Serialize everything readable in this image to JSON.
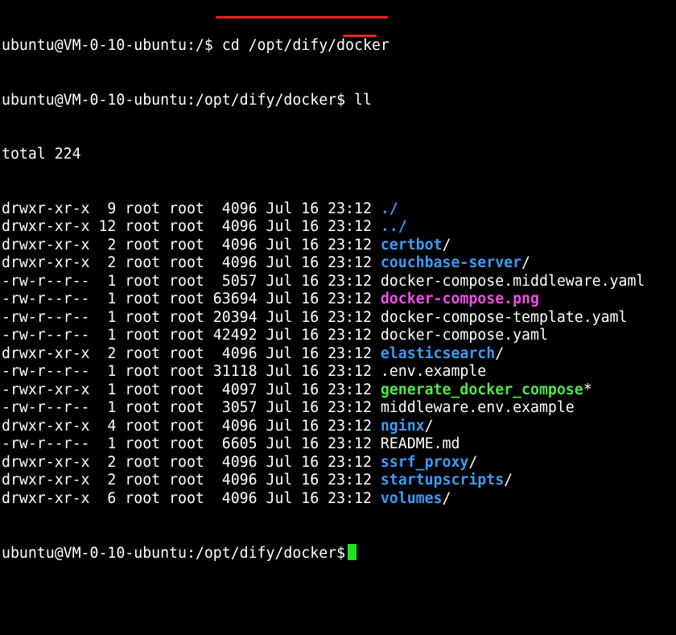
{
  "prompt_prefix_1": "ubuntu@VM-0-10-ubuntu:/$ ",
  "command_1": "cd /opt/dify/docker",
  "prompt_prefix_2": "ubuntu@VM-0-10-ubuntu:/opt/dify/docker$ ",
  "command_2": "ll",
  "total": "total 224",
  "listing": [
    {
      "meta": "drwxr-xr-x  9 root root  4096 Jul 16 23:12 ",
      "name": "./",
      "suffix": "",
      "kind": "dir"
    },
    {
      "meta": "drwxr-xr-x 12 root root  4096 Jul 16 23:12 ",
      "name": "../",
      "suffix": "",
      "kind": "dir"
    },
    {
      "meta": "drwxr-xr-x  2 root root  4096 Jul 16 23:12 ",
      "name": "certbot",
      "suffix": "/",
      "kind": "dir"
    },
    {
      "meta": "drwxr-xr-x  2 root root  4096 Jul 16 23:12 ",
      "name": "couchbase-server",
      "suffix": "/",
      "kind": "dir"
    },
    {
      "meta": "-rw-r--r--  1 root root  5057 Jul 16 23:12 ",
      "name": "docker-compose.middleware.yaml",
      "suffix": "",
      "kind": "plain"
    },
    {
      "meta": "-rw-r--r--  1 root root 63694 Jul 16 23:12 ",
      "name": "docker-compose.png",
      "suffix": "",
      "kind": "png"
    },
    {
      "meta": "-rw-r--r--  1 root root 20394 Jul 16 23:12 ",
      "name": "docker-compose-template.yaml",
      "suffix": "",
      "kind": "plain"
    },
    {
      "meta": "-rw-r--r--  1 root root 42492 Jul 16 23:12 ",
      "name": "docker-compose.yaml",
      "suffix": "",
      "kind": "plain"
    },
    {
      "meta": "drwxr-xr-x  2 root root  4096 Jul 16 23:12 ",
      "name": "elasticsearch",
      "suffix": "/",
      "kind": "dir"
    },
    {
      "meta": "-rw-r--r--  1 root root 31118 Jul 16 23:12 ",
      "name": ".env.example",
      "suffix": "",
      "kind": "plain"
    },
    {
      "meta": "-rwxr-xr-x  1 root root  4097 Jul 16 23:12 ",
      "name": "generate_docker_compose",
      "suffix": "*",
      "kind": "exec"
    },
    {
      "meta": "-rw-r--r--  1 root root  3057 Jul 16 23:12 ",
      "name": "middleware.env.example",
      "suffix": "",
      "kind": "plain"
    },
    {
      "meta": "drwxr-xr-x  4 root root  4096 Jul 16 23:12 ",
      "name": "nginx",
      "suffix": "/",
      "kind": "dir"
    },
    {
      "meta": "-rw-r--r--  1 root root  6605 Jul 16 23:12 ",
      "name": "README.md",
      "suffix": "",
      "kind": "plain"
    },
    {
      "meta": "drwxr-xr-x  2 root root  4096 Jul 16 23:12 ",
      "name": "ssrf_proxy",
      "suffix": "/",
      "kind": "dir"
    },
    {
      "meta": "drwxr-xr-x  2 root root  4096 Jul 16 23:12 ",
      "name": "startupscripts",
      "suffix": "/",
      "kind": "dir"
    },
    {
      "meta": "drwxr-xr-x  6 root root  4096 Jul 16 23:12 ",
      "name": "volumes",
      "suffix": "/",
      "kind": "dir"
    }
  ],
  "prompt_final": "ubuntu@VM-0-10-ubuntu:/opt/dify/docker$",
  "colors": {
    "background": "#000000",
    "text": "#ffffff",
    "directory": "#3b9cf5",
    "image_file": "#f04ee8",
    "executable": "#4ee84b",
    "cursor": "#1ee61e",
    "annotation_underline": "#e8242a"
  }
}
